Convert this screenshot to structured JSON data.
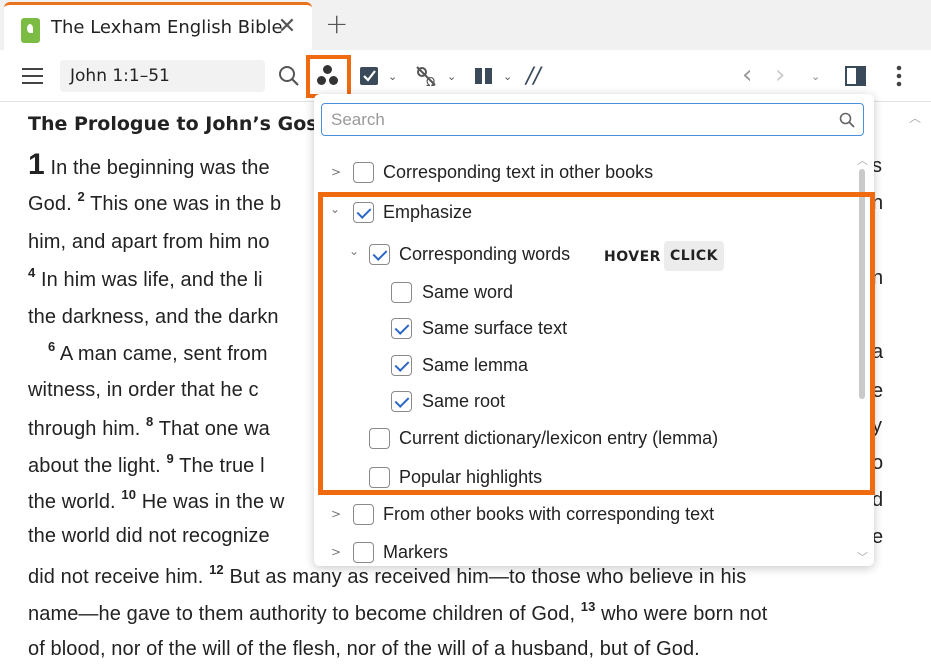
{
  "tab": {
    "title": "The Lexham English Bible",
    "close": "✕",
    "new_tab": "+"
  },
  "toolbar": {
    "reference": "John 1:1–51",
    "parallel_label": "//"
  },
  "reader": {
    "heading": "The Prologue to John’s Gospe",
    "chapter": "1",
    "lines": [
      {
        "pre": "",
        "sup": "",
        "text": "In the beginning was the"
      },
      {
        "pre": "God.",
        "sup": "2",
        "text": "This one was in the b"
      },
      {
        "pre": "him, and apart from him no",
        "sup": "",
        "text": ""
      },
      {
        "pre": "",
        "sup": "4",
        "text": "In him was life, and the li"
      },
      {
        "pre": "the darkness, and the darkn",
        "sup": "",
        "text": ""
      },
      {
        "pre": "",
        "sup": "6",
        "text": "A man came, sent from"
      },
      {
        "pre": "witness, in order that he c",
        "sup": "",
        "text": ""
      },
      {
        "pre": "through him.",
        "sup": "8",
        "text": "That one wa"
      },
      {
        "pre": "about the light.",
        "sup": "9",
        "text": "The true l"
      },
      {
        "pre": "the world.",
        "sup": "10",
        "text": "He was in the w"
      },
      {
        "pre": "the world did not recognize",
        "sup": "",
        "text": ""
      }
    ],
    "right_fragments": [
      "s",
      "n",
      "n",
      "a",
      "e",
      "y",
      "o",
      "d",
      "e"
    ],
    "full_lines": [
      {
        "pre": "did not receive him.",
        "sup": "12",
        "text": "But as many as received him—to those who believe in his"
      },
      {
        "pre": "name—he gave to them authority to become children of God,",
        "sup": "13",
        "text": "who were born not"
      },
      {
        "pre": "of blood, nor of the will of the flesh, nor of the will of a husband, but of God.",
        "sup": "",
        "text": ""
      }
    ]
  },
  "panel": {
    "search_placeholder": "Search",
    "items": [
      {
        "label": "Corresponding text in other books",
        "checked": false
      },
      {
        "label": "Emphasize",
        "checked": true
      },
      {
        "label": "Corresponding words",
        "checked": true
      },
      {
        "label": "Same word",
        "checked": false
      },
      {
        "label": "Same surface text",
        "checked": true
      },
      {
        "label": "Same lemma",
        "checked": true
      },
      {
        "label": "Same root",
        "checked": true
      },
      {
        "label": "Current dictionary/lexicon entry (lemma)",
        "checked": false
      },
      {
        "label": "Popular highlights",
        "checked": false
      },
      {
        "label": "From other books with corresponding text",
        "checked": false
      },
      {
        "label": "Markers",
        "checked": false
      }
    ],
    "mode_hover": "HOVER",
    "mode_click": "CLICK",
    "active_mode": "CLICK"
  },
  "colors": {
    "accent_orange": "#f06a0f",
    "check_blue": "#2a67c7",
    "tab_icon_green": "#7cbc45"
  },
  "icons": [
    "hamburger-icon",
    "search-icon",
    "visual-filters-icon",
    "checklist-icon",
    "interlinear-icon",
    "columns-icon",
    "back-arrow-icon",
    "forward-arrow-icon",
    "layout-icon",
    "more-icon",
    "close-icon",
    "plus-icon"
  ]
}
